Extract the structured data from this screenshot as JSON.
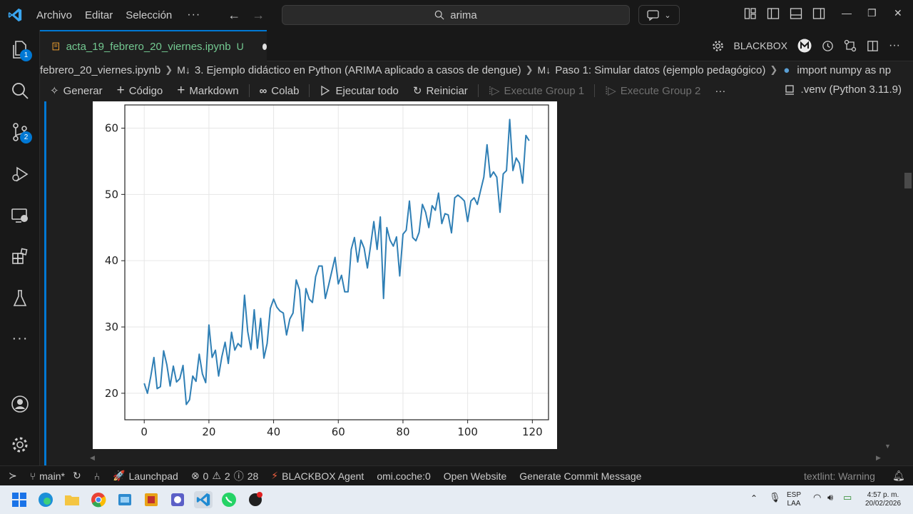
{
  "titlebar": {
    "menu": [
      "Archivo",
      "Editar",
      "Selección"
    ],
    "more": "···",
    "search_text": "arima"
  },
  "activity": {
    "explorer_badge": "1",
    "scm_badge": "2",
    "more": "···"
  },
  "tab": {
    "filename": "acta_19_febrero_20_viernes.ipynb",
    "status": "U",
    "blackbox_label": "BLACKBOX"
  },
  "breadcrumb": {
    "file": "febrero_20_viernes.ipynb",
    "section": "3. Ejemplo didáctico en Python (ARIMA aplicado a casos de dengue)",
    "subsection": "Paso 1: Simular datos (ejemplo pedagógico)",
    "code": "import numpy as np"
  },
  "toolbar": {
    "generate": "Generar",
    "code": "Código",
    "markdown": "Markdown",
    "colab": "Colab",
    "run_all": "Ejecutar todo",
    "restart": "Reiniciar",
    "exec_group1": "Execute Group 1",
    "exec_group2": "Execute Group 2",
    "more": "···",
    "kernel": ".venv (Python 3.11.9)"
  },
  "status": {
    "branch": "main*",
    "launchpad": "Launchpad",
    "errors": "0",
    "warnings": "2",
    "infos": "28",
    "blackbox_agent": "BLACKBOX Agent",
    "omi": "omi.coche:0",
    "open_website": "Open Website",
    "commit_msg": "Generate Commit Message",
    "textlint": "textlint: Warning"
  },
  "taskbar": {
    "lang1": "ESP",
    "lang2": "LAA",
    "time": "4:57 p. m.",
    "date": "20/02/2026"
  },
  "colors": {
    "accent": "#0078d4",
    "line": "#2f7fb5",
    "untracked": "#73c991"
  },
  "chart_data": {
    "type": "line",
    "x_ticks": [
      0,
      20,
      40,
      60,
      80,
      100,
      120
    ],
    "y_ticks": [
      20,
      30,
      40,
      50,
      60
    ],
    "xlim": [
      -6,
      125
    ],
    "ylim": [
      16,
      63.5
    ],
    "grid": true,
    "series": [
      {
        "values": [
          21.5,
          20.0,
          22.5,
          25.4,
          20.7,
          21.0,
          26.4,
          24.3,
          21.1,
          24.1,
          21.7,
          22.2,
          24.2,
          18.3,
          19.0,
          22.6,
          21.8,
          25.9,
          22.9,
          21.6,
          30.3,
          25.4,
          26.5,
          22.6,
          25.5,
          27.7,
          24.5,
          29.2,
          26.5,
          27.5,
          27.0,
          34.8,
          29.3,
          26.6,
          32.6,
          26.8,
          31.3,
          25.3,
          27.5,
          32.8,
          34.2,
          33.0,
          32.4,
          32.1,
          28.8,
          31.2,
          32.1,
          37.1,
          35.6,
          29.4,
          35.8,
          34.2,
          33.7,
          37.6,
          39.2,
          39.2,
          34.3,
          36.3,
          38.4,
          40.5,
          36.5,
          37.8,
          35.3,
          35.3,
          41.7,
          43.5,
          39.8,
          43.1,
          41.9,
          38.9,
          42.3,
          45.9,
          41.7,
          46.6,
          34.3,
          45.0,
          43.1,
          42.2,
          43.6,
          37.7,
          44.0,
          44.6,
          49.0,
          43.5,
          43.0,
          44.3,
          48.5,
          47.3,
          45.0,
          48.3,
          47.6,
          50.2,
          45.6,
          47.1,
          46.9,
          44.2,
          49.5,
          49.9,
          49.5,
          49.0,
          45.9,
          49.0,
          49.5,
          48.5,
          50.6,
          52.6,
          57.5,
          52.6,
          53.4,
          52.6,
          47.3,
          53.1,
          53.6,
          61.3,
          53.6,
          55.5,
          54.7,
          51.7,
          58.9,
          58.1
        ]
      }
    ]
  }
}
